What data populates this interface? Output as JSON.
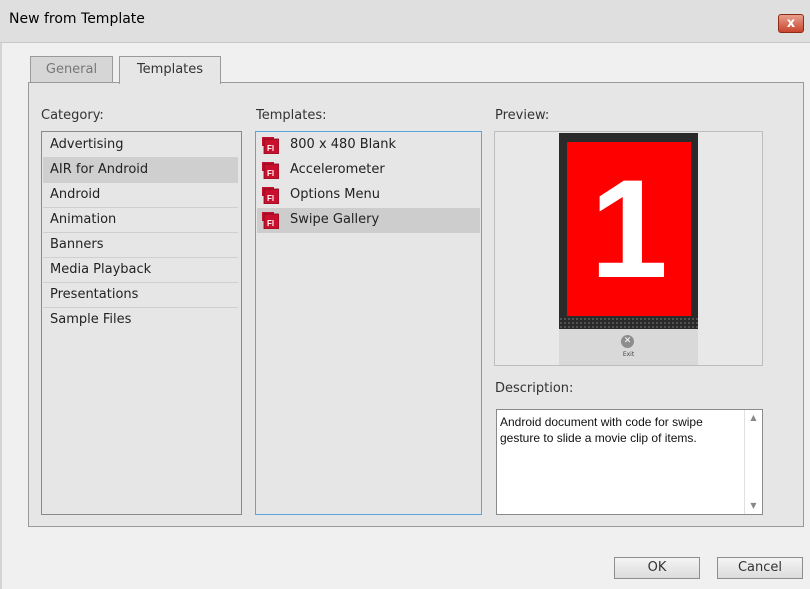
{
  "dialog": {
    "title": "New from Template",
    "close_label": "x"
  },
  "tabs": [
    {
      "label": "General",
      "active": false
    },
    {
      "label": "Templates",
      "active": true
    }
  ],
  "category": {
    "label": "Category:",
    "items": [
      {
        "label": "Advertising",
        "selected": false
      },
      {
        "label": "AIR for Android",
        "selected": true
      },
      {
        "label": "Android",
        "selected": false
      },
      {
        "label": "Animation",
        "selected": false
      },
      {
        "label": "Banners",
        "selected": false
      },
      {
        "label": "Media Playback",
        "selected": false
      },
      {
        "label": "Presentations",
        "selected": false
      },
      {
        "label": "Sample Files",
        "selected": false
      }
    ]
  },
  "templates": {
    "label": "Templates:",
    "icon": "fl-file-icon",
    "icon_text": "Fl",
    "icon_color": "#c8102e",
    "items": [
      {
        "label": "800 x 480 Blank",
        "selected": false
      },
      {
        "label": "Accelerometer",
        "selected": false
      },
      {
        "label": "Options Menu",
        "selected": false
      },
      {
        "label": "Swipe Gallery",
        "selected": true
      }
    ]
  },
  "preview": {
    "label": "Preview:",
    "number": "1",
    "screen_color": "#ff0000",
    "exit_label": "Exit"
  },
  "description": {
    "label": "Description:",
    "text": "Android document with code for swipe gesture to slide a movie clip of items."
  },
  "buttons": {
    "ok": "OK",
    "cancel": "Cancel"
  }
}
